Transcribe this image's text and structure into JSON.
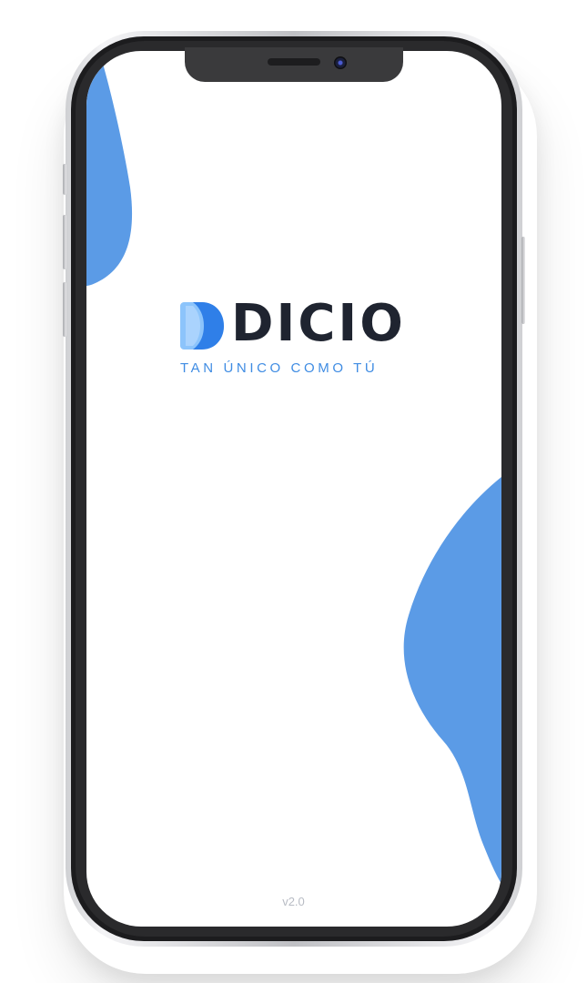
{
  "app": {
    "brand": "DICIO",
    "tagline": "TAN ÚNICO COMO TÚ",
    "version": "v2.0"
  },
  "colors": {
    "accent": "#5b9be6",
    "accent_light": "#8cc4fb",
    "wordmark": "#1f2430",
    "tagline": "#3f8ce3",
    "version": "#b8bcc4"
  },
  "icons": {
    "logo_mark": "dicio-d-logo-icon",
    "camera": "front-camera-icon",
    "speaker": "earpiece-speaker-icon"
  }
}
